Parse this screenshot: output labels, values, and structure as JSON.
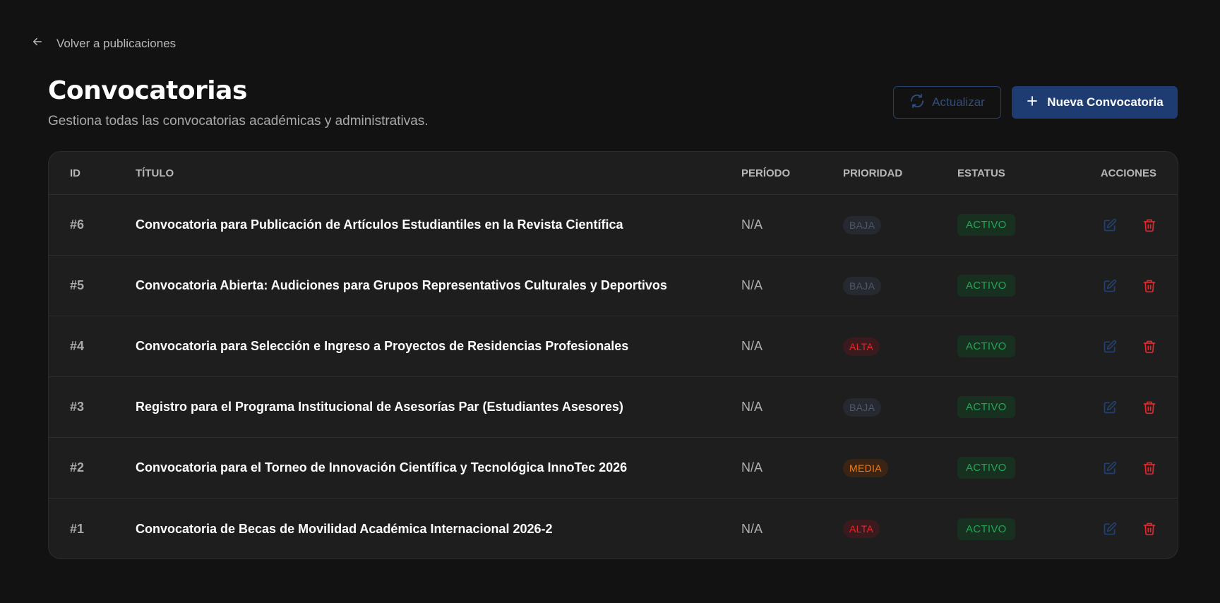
{
  "nav": {
    "back_label": "Volver a publicaciones"
  },
  "header": {
    "title": "Convocatorias",
    "subtitle": "Gestiona todas las convocatorias académicas y administrativas.",
    "refresh_label": "Actualizar",
    "new_label": "Nueva Convocatoria"
  },
  "table": {
    "columns": {
      "id": "ID",
      "title": "TÍTULO",
      "period": "PERÍODO",
      "priority": "PRIORIDAD",
      "status": "ESTATUS",
      "actions": "ACCIONES"
    },
    "rows": [
      {
        "id": "#6",
        "title": "Convocatoria para Publicación de Artículos Estudiantiles en la Revista Científica",
        "period": "N/A",
        "priority": "BAJA",
        "priority_level": "baja",
        "status": "ACTIVO"
      },
      {
        "id": "#5",
        "title": "Convocatoria Abierta: Audiciones para Grupos Representativos Culturales y Deportivos",
        "period": "N/A",
        "priority": "BAJA",
        "priority_level": "baja",
        "status": "ACTIVO"
      },
      {
        "id": "#4",
        "title": "Convocatoria para Selección e Ingreso a Proyectos de Residencias Profesionales",
        "period": "N/A",
        "priority": "ALTA",
        "priority_level": "alta",
        "status": "ACTIVO"
      },
      {
        "id": "#3",
        "title": "Registro para el Programa Institucional de Asesorías Par (Estudiantes Asesores)",
        "period": "N/A",
        "priority": "BAJA",
        "priority_level": "baja",
        "status": "ACTIVO"
      },
      {
        "id": "#2",
        "title": "Convocatoria para el Torneo de Innovación Científica y Tecnológica InnoTec 2026",
        "period": "N/A",
        "priority": "MEDIA",
        "priority_level": "media",
        "status": "ACTIVO"
      },
      {
        "id": "#1",
        "title": "Convocatoria de Becas de Movilidad Académica Internacional 2026-2",
        "period": "N/A",
        "priority": "ALTA",
        "priority_level": "alta",
        "status": "ACTIVO"
      }
    ]
  },
  "colors": {
    "background": "#121212",
    "card": "#1e1e1e",
    "primary": "#1e3c72",
    "status_active": "#1fa956",
    "priority_alta": "#e5262b",
    "priority_media": "#ef7d1d",
    "priority_baja": "#4d5868",
    "delete": "#e5262b",
    "edit": "#24406d"
  },
  "icons": {
    "back": "arrow-left-icon",
    "refresh": "refresh-icon",
    "new": "plus-icon",
    "edit": "edit-icon",
    "delete": "trash-icon"
  }
}
